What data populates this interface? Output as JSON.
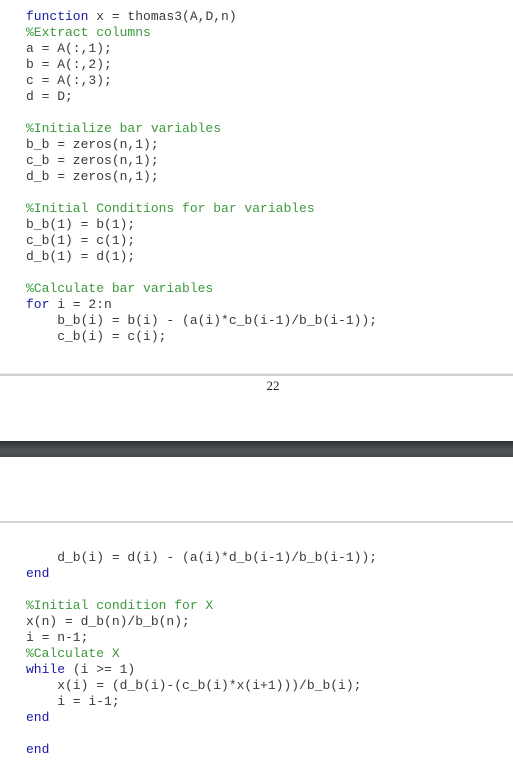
{
  "colors": {
    "keyword": "#1a1aa6",
    "comment": "#3c9a3c",
    "text": "#3a3a3a",
    "page_gap": "#45494c"
  },
  "page1": {
    "lines": [
      [
        {
          "t": "keyword",
          "v": "function"
        },
        {
          "t": "plain",
          "v": " x = thomas3(A,D,n)"
        }
      ],
      [
        {
          "t": "comment",
          "v": "%Extract columns"
        }
      ],
      [
        {
          "t": "plain",
          "v": "a = A(:,1);"
        }
      ],
      [
        {
          "t": "plain",
          "v": "b = A(:,2);"
        }
      ],
      [
        {
          "t": "plain",
          "v": "c = A(:,3);"
        }
      ],
      [
        {
          "t": "plain",
          "v": "d = D;"
        }
      ],
      [],
      [
        {
          "t": "comment",
          "v": "%Initialize bar variables"
        }
      ],
      [
        {
          "t": "plain",
          "v": "b_b = zeros(n,1);"
        }
      ],
      [
        {
          "t": "plain",
          "v": "c_b = zeros(n,1);"
        }
      ],
      [
        {
          "t": "plain",
          "v": "d_b = zeros(n,1);"
        }
      ],
      [],
      [
        {
          "t": "comment",
          "v": "%Initial Conditions for bar variables"
        }
      ],
      [
        {
          "t": "plain",
          "v": "b_b(1) = b(1);"
        }
      ],
      [
        {
          "t": "plain",
          "v": "c_b(1) = c(1);"
        }
      ],
      [
        {
          "t": "plain",
          "v": "d_b(1) = d(1);"
        }
      ],
      [],
      [
        {
          "t": "comment",
          "v": "%Calculate bar variables"
        }
      ],
      [
        {
          "t": "keyword",
          "v": "for"
        },
        {
          "t": "plain",
          "v": " i = 2:n"
        }
      ],
      [
        {
          "t": "plain",
          "v": "    b_b(i) = b(i) - (a(i)*c_b(i-1)/b_b(i-1));"
        }
      ],
      [
        {
          "t": "plain",
          "v": "    c_b(i) = c(i);"
        }
      ]
    ],
    "page_number": "22"
  },
  "page2": {
    "lines": [
      [
        {
          "t": "plain",
          "v": "    d_b(i) = d(i) - (a(i)*d_b(i-1)/b_b(i-1));"
        }
      ],
      [
        {
          "t": "keyword",
          "v": "end"
        }
      ],
      [],
      [
        {
          "t": "comment",
          "v": "%Initial condition for X"
        }
      ],
      [
        {
          "t": "plain",
          "v": "x(n) = d_b(n)/b_b(n);"
        }
      ],
      [
        {
          "t": "plain",
          "v": "i = n-1;"
        }
      ],
      [
        {
          "t": "comment",
          "v": "%Calculate X"
        }
      ],
      [
        {
          "t": "keyword",
          "v": "while"
        },
        {
          "t": "plain",
          "v": " (i >= 1)"
        }
      ],
      [
        {
          "t": "plain",
          "v": "    x(i) = (d_b(i)-(c_b(i)*x(i+1)))/b_b(i);"
        }
      ],
      [
        {
          "t": "plain",
          "v": "    i = i-1;"
        }
      ],
      [
        {
          "t": "keyword",
          "v": "end"
        }
      ],
      [],
      [
        {
          "t": "keyword",
          "v": "end"
        }
      ]
    ]
  }
}
